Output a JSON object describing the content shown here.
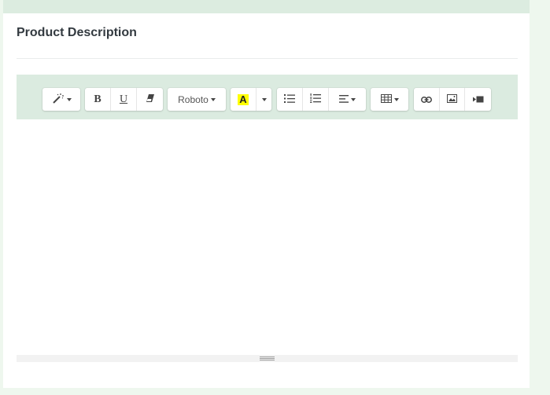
{
  "card": {
    "title": "Product Description"
  },
  "toolbar": {
    "style_icon": "magic-wand-icon",
    "bold_label": "B",
    "underline_label": "U",
    "eraser_icon": "eraser-icon",
    "font_name": "Roboto",
    "highlight_letter": "A",
    "highlight_color": "#ffff00",
    "unordered_list_icon": "unordered-list-icon",
    "ordered_list_icon": "ordered-list-icon",
    "align_icon": "align-left-icon",
    "table_icon": "table-icon",
    "link_icon": "link-icon",
    "picture_icon": "picture-icon",
    "video_icon": "video-icon"
  },
  "editor": {
    "content": ""
  },
  "colors": {
    "toolbar_bg": "#dbebe0",
    "page_bg": "#eef7ee",
    "title_color": "#333a40"
  }
}
